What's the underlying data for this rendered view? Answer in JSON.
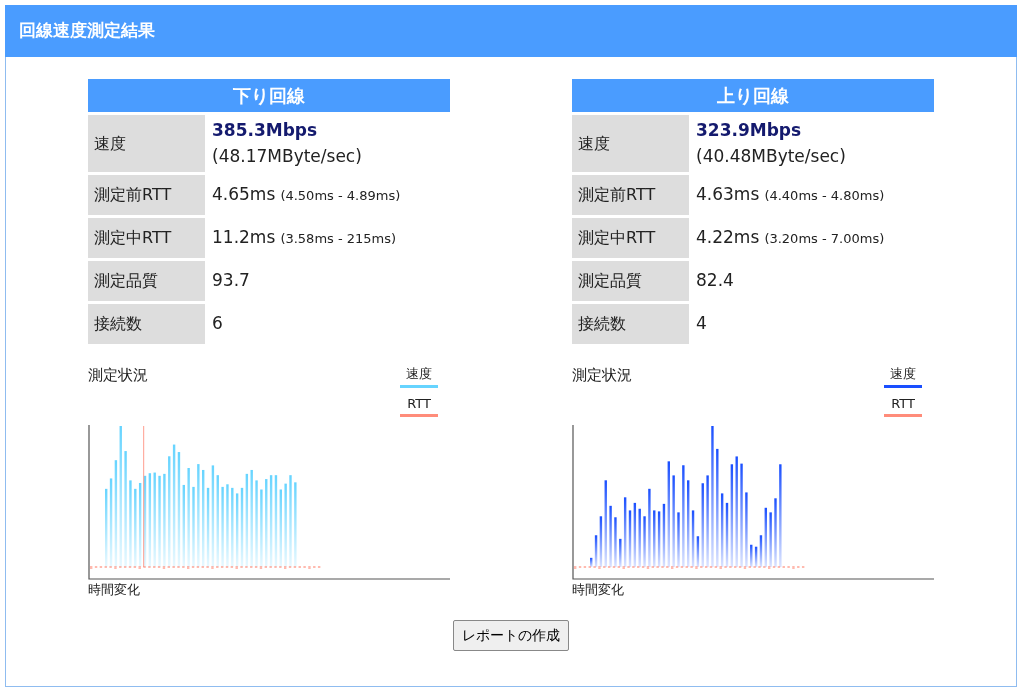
{
  "header": {
    "title": "回線速度測定結果"
  },
  "panels": [
    {
      "title": "下り回線",
      "rows": [
        {
          "kind": "speed",
          "label": "速度",
          "value": "385.3Mbps",
          "sub": "(48.17MByte/sec)"
        },
        {
          "kind": "range",
          "label": "測定前RTT",
          "value": "4.65ms",
          "sub": "(4.50ms - 4.89ms)"
        },
        {
          "kind": "range",
          "label": "測定中RTT",
          "value": "11.2ms",
          "sub": "(3.58ms - 215ms)"
        },
        {
          "kind": "plain",
          "label": "測定品質",
          "value": "93.7"
        },
        {
          "kind": "plain",
          "label": "接続数",
          "value": "6"
        }
      ],
      "chart": {
        "title": "測定状況",
        "legend": [
          {
            "label": "速度",
            "color": "#66d4ff"
          },
          {
            "label": "RTT",
            "color": "#ff8c7a"
          }
        ],
        "xlabel": "時間変化"
      }
    },
    {
      "title": "上り回線",
      "rows": [
        {
          "kind": "speed",
          "label": "速度",
          "value": "323.9Mbps",
          "sub": "(40.48MByte/sec)"
        },
        {
          "kind": "range",
          "label": "測定前RTT",
          "value": "4.63ms",
          "sub": "(4.40ms - 4.80ms)"
        },
        {
          "kind": "range",
          "label": "測定中RTT",
          "value": "4.22ms",
          "sub": "(3.20ms - 7.00ms)"
        },
        {
          "kind": "plain",
          "label": "測定品質",
          "value": "82.4"
        },
        {
          "kind": "plain",
          "label": "接続数",
          "value": "4"
        }
      ],
      "chart": {
        "title": "測定状況",
        "legend": [
          {
            "label": "速度",
            "color": "#1a4fff"
          },
          {
            "label": "RTT",
            "color": "#ff8c7a"
          }
        ],
        "xlabel": "時間変化"
      }
    }
  ],
  "button": "レポートの作成"
}
